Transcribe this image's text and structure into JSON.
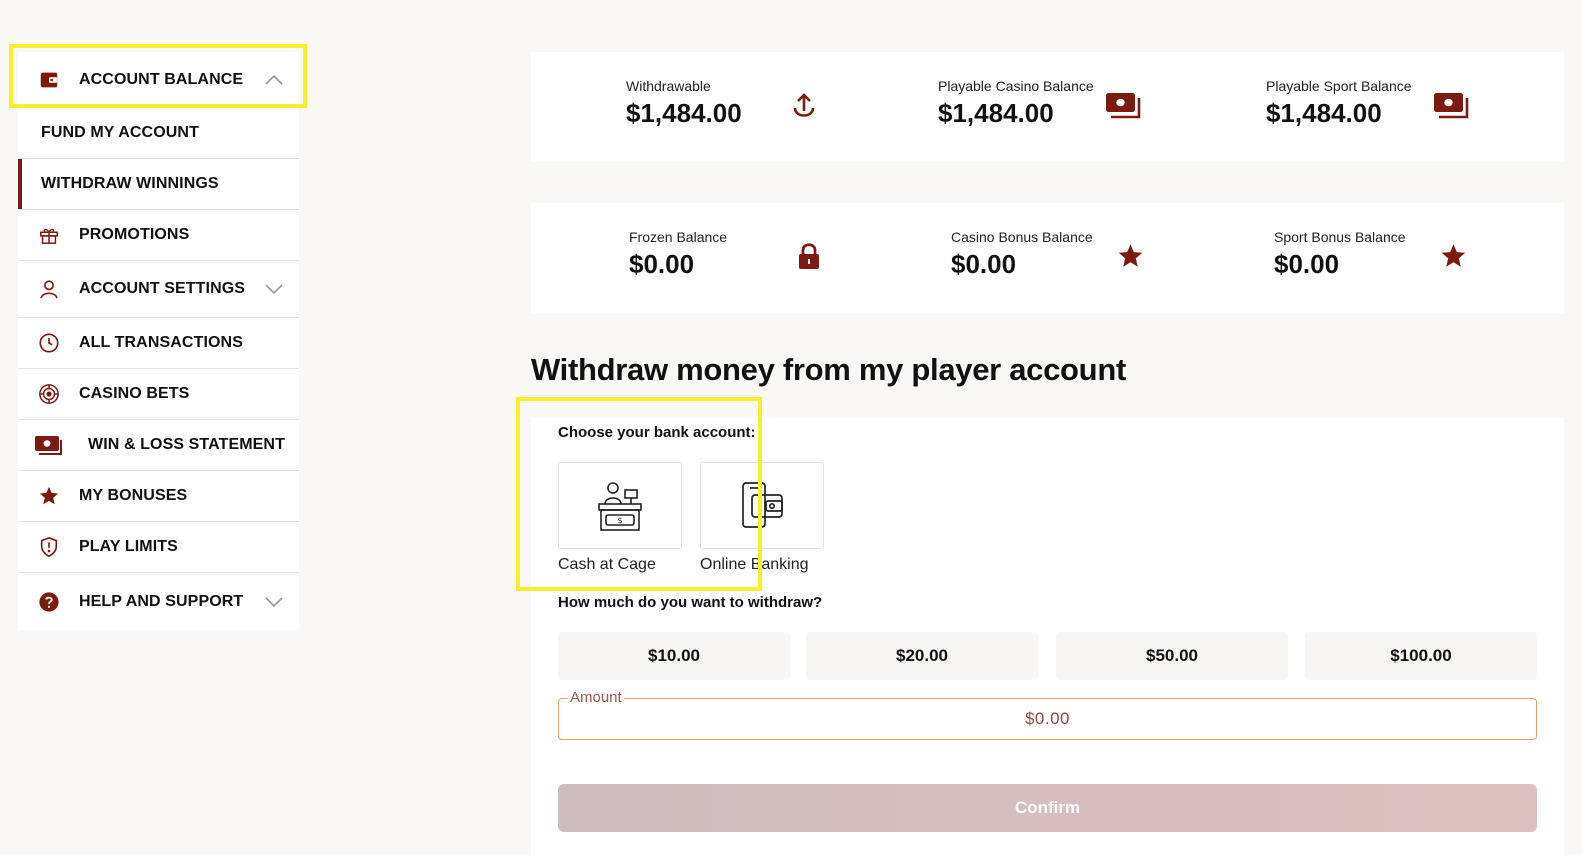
{
  "sidebar": {
    "account_balance": "ACCOUNT BALANCE",
    "fund_my_account": "FUND MY ACCOUNT",
    "withdraw_winnings": "WITHDRAW WINNINGS",
    "promotions": "PROMOTIONS",
    "account_settings": "ACCOUNT SETTINGS",
    "all_transactions": "ALL TRANSACTIONS",
    "casino_bets": "CASINO BETS",
    "win_loss_statement": "WIN & LOSS STATEMENT",
    "my_bonuses": "MY BONUSES",
    "play_limits": "PLAY LIMITS",
    "help_and_support": "HELP AND SUPPORT"
  },
  "balances": {
    "withdrawable": {
      "label": "Withdrawable",
      "value": "$1,484.00",
      "icon": "upload-arrow-icon"
    },
    "playable_casino": {
      "label": "Playable Casino Balance",
      "value": "$1,484.00",
      "icon": "cash-icon"
    },
    "playable_sport": {
      "label": "Playable Sport Balance",
      "value": "$1,484.00",
      "icon": "cash-icon"
    },
    "frozen": {
      "label": "Frozen Balance",
      "value": "$0.00",
      "icon": "lock-icon"
    },
    "casino_bonus": {
      "label": "Casino Bonus Balance",
      "value": "$0.00",
      "icon": "star-icon"
    },
    "sport_bonus": {
      "label": "Sport Bonus Balance",
      "value": "$0.00",
      "icon": "star-icon"
    }
  },
  "withdraw": {
    "title": "Withdraw money from my player account",
    "choose_label": "Choose your bank account:",
    "options": [
      "Cash at Cage",
      "Online Banking"
    ],
    "howmuch_label": "How much do you want to withdraw?",
    "presets": [
      "$10.00",
      "$20.00",
      "$50.00",
      "$100.00"
    ],
    "amount_label": "Amount",
    "amount_placeholder": "$0.00",
    "confirm_label": "Confirm"
  },
  "colors": {
    "accent": "#7a1a10",
    "highlight": "#f5f02a",
    "page_bg": "#faf7f7"
  }
}
